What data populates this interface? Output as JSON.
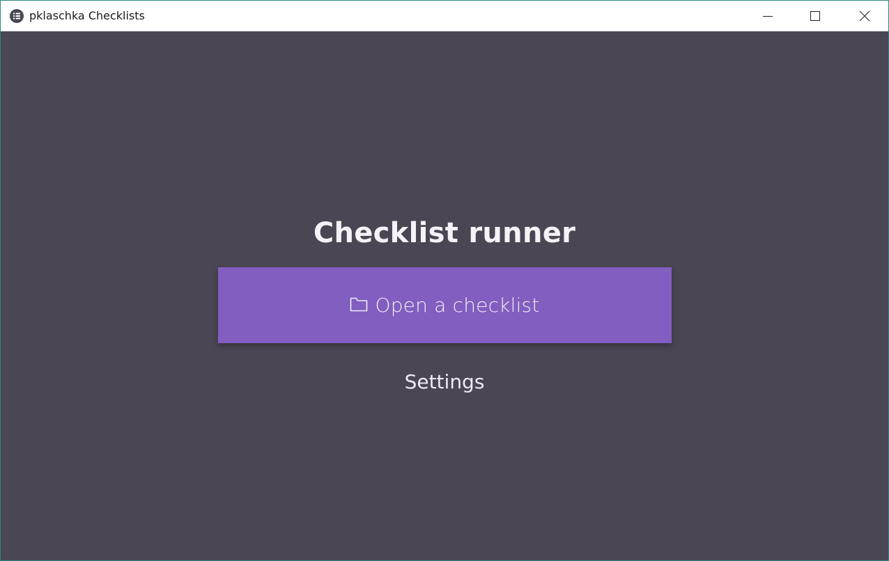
{
  "window": {
    "title": "pklaschka Checklists",
    "app_icon": "list-icon",
    "controls": {
      "minimize_icon": "minimize-icon",
      "maximize_icon": "maximize-icon",
      "close_icon": "close-icon"
    }
  },
  "main": {
    "heading": "Checklist runner",
    "open_button": {
      "label": "Open a checklist",
      "icon": "folder-icon"
    },
    "settings_link": "Settings"
  },
  "colors": {
    "background": "#4a4653",
    "accent": "#815ebf",
    "titlebar": "#ffffff",
    "text_light": "#f5f3f7"
  }
}
